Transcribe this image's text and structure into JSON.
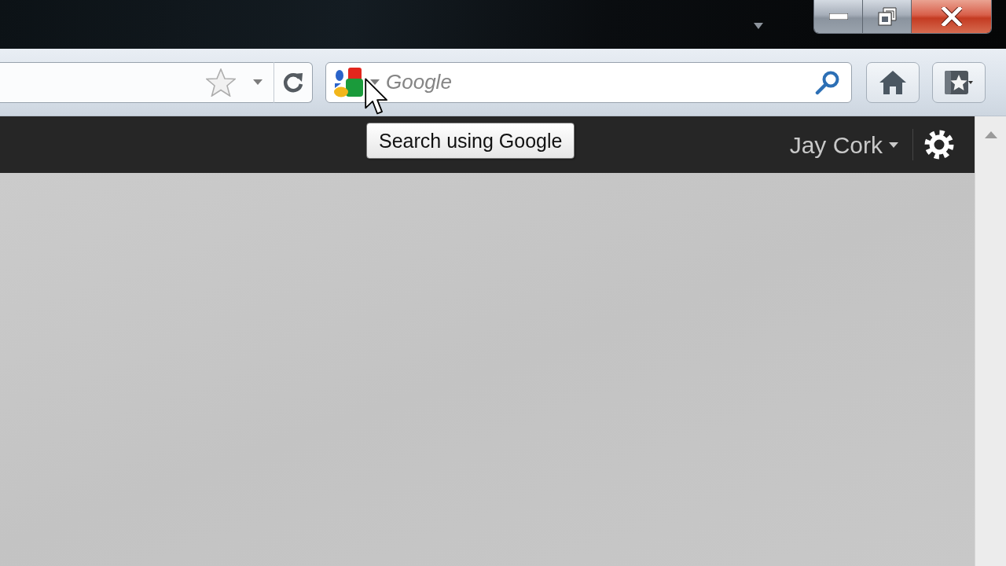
{
  "toolbar": {
    "search_field": {
      "placeholder": "Google"
    }
  },
  "tooltip": {
    "text": "Search using Google"
  },
  "header": {
    "user_menu": {
      "label": "Jay Cork"
    }
  }
}
